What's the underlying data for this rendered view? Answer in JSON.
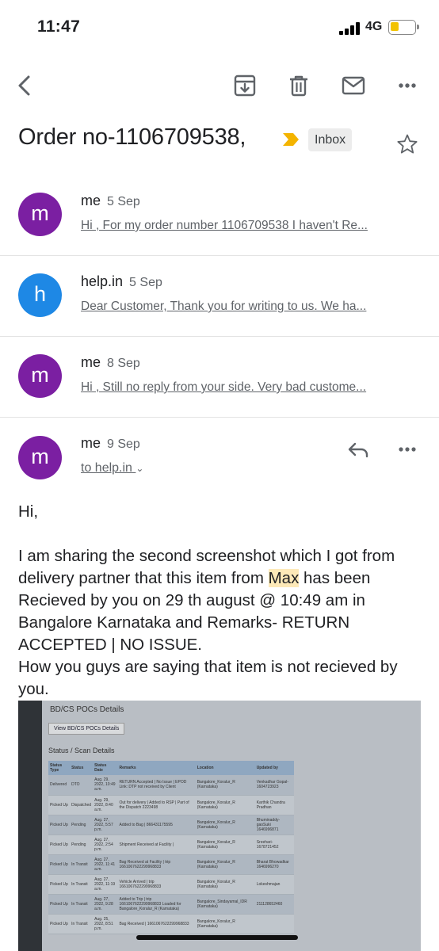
{
  "status_bar": {
    "time": "11:47",
    "network": "4G"
  },
  "subject": {
    "title": "Order no-1106709538,",
    "label": "Inbox"
  },
  "messages": [
    {
      "avatar_letter": "m",
      "avatar_color": "#7b1fa2",
      "sender": "me",
      "date": "5 Sep",
      "snippet": "Hi , For my order number 1106709538 I haven't Re..."
    },
    {
      "avatar_letter": "h",
      "avatar_color": "#1e88e5",
      "sender": "help.in",
      "date": "5 Sep",
      "snippet": "Dear Customer, Thank you for writing to us. We ha..."
    },
    {
      "avatar_letter": "m",
      "avatar_color": "#7b1fa2",
      "sender": "me",
      "date": "8 Sep",
      "snippet": "Hi , Still no reply from your side. Very bad custome..."
    }
  ],
  "open_message": {
    "avatar_letter": "m",
    "avatar_color": "#7b1fa2",
    "sender": "me",
    "date": "9 Sep",
    "to": "to help.in",
    "greeting": "Hi,",
    "para1_a": "I am sharing the second screenshot which I got from delivery partner that this item from ",
    "para1_hl": "Max",
    "para1_b": " has been Recieved by you on 29 th august @ 10:49 am in Bangalore Karnataka  and Remarks- RETURN ACCEPTED | NO ISSUE.",
    "para2": "How you guys are saying that item is not recieved by you."
  },
  "attachment": {
    "title": "BD/CS POCs Details",
    "button": "View BD/CS POCs Details",
    "subtitle": "Status / Scan Details",
    "headers": [
      "Status Type",
      "Status",
      "Status Date",
      "Remarks",
      "Location",
      "Updated by"
    ],
    "rows": [
      [
        "Delivered",
        "DTO",
        "Aug. 29, 2022, 10:49 a.m.",
        "RETURN Accepted | No Issue | EPOD Link: DTP not received by Client",
        "Bangalore_Koralur_R (Karnataka)",
        "Venkadhar Gopal-1604723923"
      ],
      [
        "Picked Up",
        "Dispatched",
        "Aug. 29, 2022, 8:40 a.m.",
        "Out for delivery | Added to RSP | Part of the Dispatch 2223498",
        "Bangalore_Koralur_R (Karnataka)",
        "Karthik Chandra Pradhan"
      ],
      [
        "Picked Up",
        "Pending",
        "Aug. 27, 2022, 5:57 p.m.",
        "Added to Bag | 866431175595",
        "Bangalore_Koralur_R (Karnataka)",
        "Bhuminaddy-gaoSuki 1646996871"
      ],
      [
        "Picked Up",
        "Pending",
        "Aug. 27, 2022, 2:54 p.m.",
        "Shipment Received at Facility |",
        "Bangalore_Koralur_R (Karnataka)",
        "Sreehari-1678721452"
      ],
      [
        "Picked Up",
        "In Transit",
        "Aug. 27, 2022, 11:41 a.m.",
        "Bag Received at Facility | trip 1661067622299968833",
        "Bangalore_Koralur_R (Karnataka)",
        "Bharat Bhowadkar 1646996270"
      ],
      [
        "Picked Up",
        "In Transit",
        "Aug. 27, 2022, 11:19 a.m.",
        "Vehicle Arrived | trip 1661067622299968833",
        "Bangalore_Koralur_R (Karnataka)",
        "Lokeshmajan"
      ],
      [
        "Picked Up",
        "In Transit",
        "Aug. 27, 2022, 9:28 a.m.",
        "Added to Trip | trip 1661067622299968833 Loaded for Bangalore_Koralur_R (Karnataka)",
        "Bangalore_Sindayamal_IDR (Karnataka)",
        "211128652460"
      ],
      [
        "Picked Up",
        "In Transit",
        "Aug. 25, 2022, 8:51 p.m.",
        "Bag Received | 1661067622299968833",
        "Bangalore_Koralur_R (Karnataka)",
        ""
      ]
    ]
  }
}
